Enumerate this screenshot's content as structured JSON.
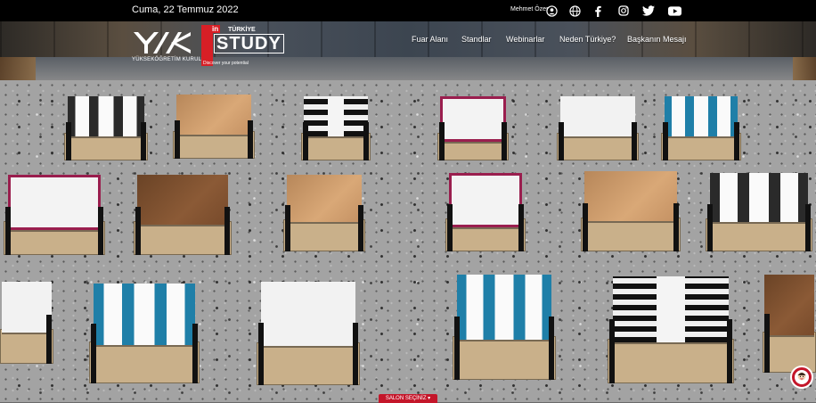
{
  "topbar": {
    "date": "Cuma, 22 Temmuz 2022",
    "user": "Mehmet Özer",
    "icons": [
      "user-icon",
      "globe-icon",
      "facebook-icon",
      "instagram-icon",
      "twitter-icon",
      "youtube-icon"
    ]
  },
  "brand": {
    "yok_caption": "YÜKSEKÖĞRETİM KURULU",
    "study_in": "in",
    "study_country": "TÜRKİYE",
    "study_word": "STUDY",
    "study_tagline": "Discover your potential"
  },
  "nav": {
    "items": [
      {
        "label": "Fuar Alanı"
      },
      {
        "label": "Standlar"
      },
      {
        "label": "Webinarlar"
      },
      {
        "label": "Neden Türkiye?"
      },
      {
        "label": "Başkanın Mesajı"
      }
    ]
  },
  "controls": {
    "salon_label": "SALON SEÇİNİZ",
    "chat_icon": "chat-avatar-icon"
  },
  "colors": {
    "accent": "#c4162a",
    "topbar": "#000000",
    "brand_red": "#d71f26"
  }
}
